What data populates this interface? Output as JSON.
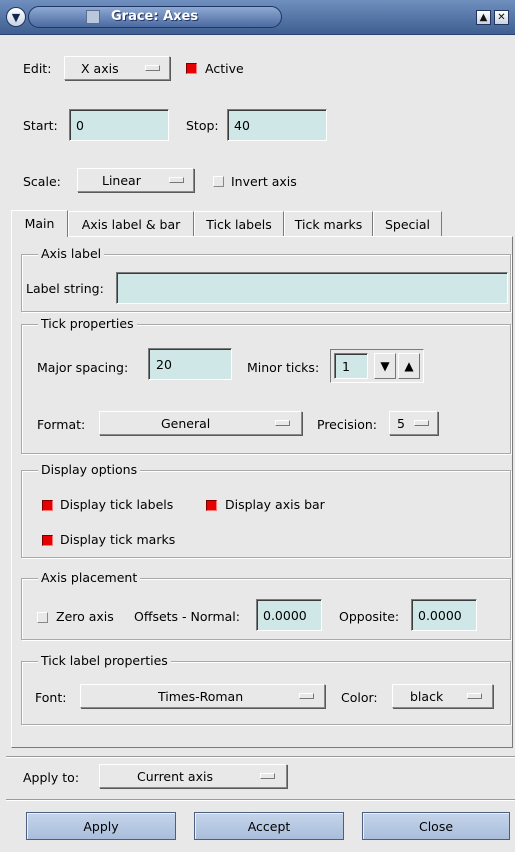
{
  "window": {
    "title": "Grace: Axes"
  },
  "edit": {
    "label": "Edit:",
    "value": "X axis",
    "active_label": "Active",
    "active_checked": true
  },
  "range": {
    "start_label": "Start:",
    "start_value": "0",
    "stop_label": "Stop:",
    "stop_value": "40"
  },
  "scale": {
    "label": "Scale:",
    "value": "Linear",
    "invert_label": "Invert axis",
    "invert_checked": false
  },
  "tabs": [
    "Main",
    "Axis label & bar",
    "Tick labels",
    "Tick marks",
    "Special"
  ],
  "axis_label": {
    "frame_title": "Axis label",
    "string_label": "Label string:",
    "string_value": ""
  },
  "tick_properties": {
    "frame_title": "Tick properties",
    "major_label": "Major spacing:",
    "major_value": "20",
    "minor_label": "Minor ticks:",
    "minor_value": "1",
    "format_label": "Format:",
    "format_value": "General",
    "precision_label": "Precision:",
    "precision_value": "5"
  },
  "display_options": {
    "frame_title": "Display options",
    "tick_labels": "Display tick labels",
    "axis_bar": "Display axis bar",
    "tick_marks": "Display tick marks"
  },
  "axis_placement": {
    "frame_title": "Axis placement",
    "zero_axis": "Zero axis",
    "offsets_label": "Offsets - Normal:",
    "normal_value": "0.0000",
    "opposite_label": "Opposite:",
    "opposite_value": "0.0000"
  },
  "tick_label_props": {
    "frame_title": "Tick label properties",
    "font_label": "Font:",
    "font_value": "Times-Roman",
    "color_label": "Color:",
    "color_value": "black"
  },
  "apply_to": {
    "label": "Apply to:",
    "value": "Current axis"
  },
  "buttons": {
    "apply": "Apply",
    "accept": "Accept",
    "close": "Close"
  }
}
